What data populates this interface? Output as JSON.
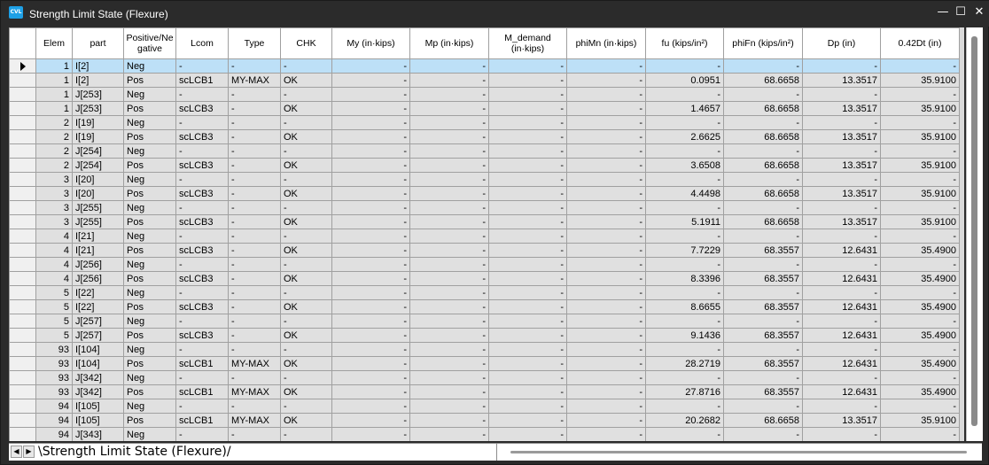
{
  "window": {
    "title": "Strength Limit State (Flexure)",
    "app_icon_text": "CVL",
    "controls": {
      "minimize": "—",
      "maximize": "☐",
      "close": "✕"
    }
  },
  "columns": [
    {
      "key": "elem",
      "label": "Elem"
    },
    {
      "key": "part",
      "label": "part"
    },
    {
      "key": "pn",
      "label": "Positive/Ne gative"
    },
    {
      "key": "lcom",
      "label": "Lcom"
    },
    {
      "key": "type",
      "label": "Type"
    },
    {
      "key": "chk",
      "label": "CHK"
    },
    {
      "key": "my",
      "label": "My (in·kips)"
    },
    {
      "key": "mp",
      "label": "Mp (in·kips)"
    },
    {
      "key": "md",
      "label": "M_demand (in·kips)"
    },
    {
      "key": "phimn",
      "label": "phiMn (in·kips)"
    },
    {
      "key": "fu",
      "label": "fu (kips/in²)"
    },
    {
      "key": "phifn",
      "label": "phiFn (kips/in²)"
    },
    {
      "key": "dp",
      "label": "Dp (in)"
    },
    {
      "key": "dt",
      "label": "0.42Dt (in)"
    }
  ],
  "rows": [
    [
      "1",
      "I[2]",
      "Neg",
      "-",
      "-",
      "-",
      "-",
      "-",
      "-",
      "-",
      "-",
      "-",
      "-",
      "-"
    ],
    [
      "1",
      "I[2]",
      "Pos",
      "scLCB1",
      "MY-MAX",
      "OK",
      "-",
      "-",
      "-",
      "-",
      "0.0951",
      "68.6658",
      "13.3517",
      "35.9100"
    ],
    [
      "1",
      "J[253]",
      "Neg",
      "-",
      "-",
      "-",
      "-",
      "-",
      "-",
      "-",
      "-",
      "-",
      "-",
      "-"
    ],
    [
      "1",
      "J[253]",
      "Pos",
      "scLCB3",
      "-",
      "OK",
      "-",
      "-",
      "-",
      "-",
      "1.4657",
      "68.6658",
      "13.3517",
      "35.9100"
    ],
    [
      "2",
      "I[19]",
      "Neg",
      "-",
      "-",
      "-",
      "-",
      "-",
      "-",
      "-",
      "-",
      "-",
      "-",
      "-"
    ],
    [
      "2",
      "I[19]",
      "Pos",
      "scLCB3",
      "-",
      "OK",
      "-",
      "-",
      "-",
      "-",
      "2.6625",
      "68.6658",
      "13.3517",
      "35.9100"
    ],
    [
      "2",
      "J[254]",
      "Neg",
      "-",
      "-",
      "-",
      "-",
      "-",
      "-",
      "-",
      "-",
      "-",
      "-",
      "-"
    ],
    [
      "2",
      "J[254]",
      "Pos",
      "scLCB3",
      "-",
      "OK",
      "-",
      "-",
      "-",
      "-",
      "3.6508",
      "68.6658",
      "13.3517",
      "35.9100"
    ],
    [
      "3",
      "I[20]",
      "Neg",
      "-",
      "-",
      "-",
      "-",
      "-",
      "-",
      "-",
      "-",
      "-",
      "-",
      "-"
    ],
    [
      "3",
      "I[20]",
      "Pos",
      "scLCB3",
      "-",
      "OK",
      "-",
      "-",
      "-",
      "-",
      "4.4498",
      "68.6658",
      "13.3517",
      "35.9100"
    ],
    [
      "3",
      "J[255]",
      "Neg",
      "-",
      "-",
      "-",
      "-",
      "-",
      "-",
      "-",
      "-",
      "-",
      "-",
      "-"
    ],
    [
      "3",
      "J[255]",
      "Pos",
      "scLCB3",
      "-",
      "OK",
      "-",
      "-",
      "-",
      "-",
      "5.1911",
      "68.6658",
      "13.3517",
      "35.9100"
    ],
    [
      "4",
      "I[21]",
      "Neg",
      "-",
      "-",
      "-",
      "-",
      "-",
      "-",
      "-",
      "-",
      "-",
      "-",
      "-"
    ],
    [
      "4",
      "I[21]",
      "Pos",
      "scLCB3",
      "-",
      "OK",
      "-",
      "-",
      "-",
      "-",
      "7.7229",
      "68.3557",
      "12.6431",
      "35.4900"
    ],
    [
      "4",
      "J[256]",
      "Neg",
      "-",
      "-",
      "-",
      "-",
      "-",
      "-",
      "-",
      "-",
      "-",
      "-",
      "-"
    ],
    [
      "4",
      "J[256]",
      "Pos",
      "scLCB3",
      "-",
      "OK",
      "-",
      "-",
      "-",
      "-",
      "8.3396",
      "68.3557",
      "12.6431",
      "35.4900"
    ],
    [
      "5",
      "I[22]",
      "Neg",
      "-",
      "-",
      "-",
      "-",
      "-",
      "-",
      "-",
      "-",
      "-",
      "-",
      "-"
    ],
    [
      "5",
      "I[22]",
      "Pos",
      "scLCB3",
      "-",
      "OK",
      "-",
      "-",
      "-",
      "-",
      "8.6655",
      "68.3557",
      "12.6431",
      "35.4900"
    ],
    [
      "5",
      "J[257]",
      "Neg",
      "-",
      "-",
      "-",
      "-",
      "-",
      "-",
      "-",
      "-",
      "-",
      "-",
      "-"
    ],
    [
      "5",
      "J[257]",
      "Pos",
      "scLCB3",
      "-",
      "OK",
      "-",
      "-",
      "-",
      "-",
      "9.1436",
      "68.3557",
      "12.6431",
      "35.4900"
    ],
    [
      "93",
      "I[104]",
      "Neg",
      "-",
      "-",
      "-",
      "-",
      "-",
      "-",
      "-",
      "-",
      "-",
      "-",
      "-"
    ],
    [
      "93",
      "I[104]",
      "Pos",
      "scLCB1",
      "MY-MAX",
      "OK",
      "-",
      "-",
      "-",
      "-",
      "28.2719",
      "68.3557",
      "12.6431",
      "35.4900"
    ],
    [
      "93",
      "J[342]",
      "Neg",
      "-",
      "-",
      "-",
      "-",
      "-",
      "-",
      "-",
      "-",
      "-",
      "-",
      "-"
    ],
    [
      "93",
      "J[342]",
      "Pos",
      "scLCB1",
      "MY-MAX",
      "OK",
      "-",
      "-",
      "-",
      "-",
      "27.8716",
      "68.3557",
      "12.6431",
      "35.4900"
    ],
    [
      "94",
      "I[105]",
      "Neg",
      "-",
      "-",
      "-",
      "-",
      "-",
      "-",
      "-",
      "-",
      "-",
      "-",
      "-"
    ],
    [
      "94",
      "I[105]",
      "Pos",
      "scLCB1",
      "MY-MAX",
      "OK",
      "-",
      "-",
      "-",
      "-",
      "20.2682",
      "68.6658",
      "13.3517",
      "35.9100"
    ],
    [
      "94",
      "J[343]",
      "Neg",
      "-",
      "-",
      "-",
      "-",
      "-",
      "-",
      "-",
      "-",
      "-",
      "-",
      "-"
    ]
  ],
  "selected_row": 0,
  "sheet_tab": {
    "label": "Strength Limit State (Flexure)"
  },
  "nav": {
    "prev": "◀",
    "next": "▶"
  }
}
